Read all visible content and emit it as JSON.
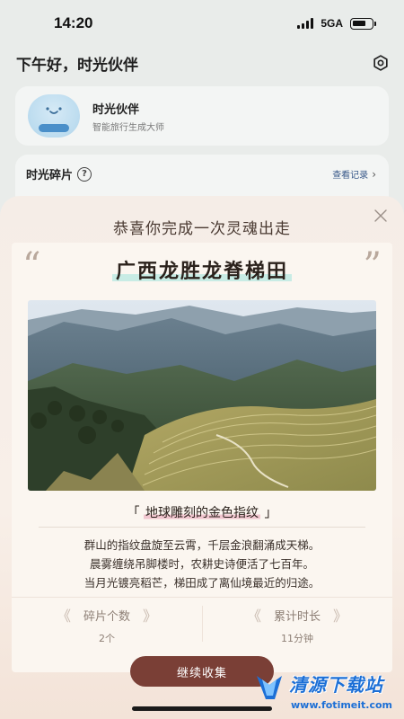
{
  "status_bar": {
    "time": "14:20",
    "network": "5GA"
  },
  "header": {
    "greeting": "下午好，时光伙伴"
  },
  "companion": {
    "name": "时光伙伴",
    "subtitle": "智能旅行生成大师"
  },
  "fragments": {
    "title": "时光碎片",
    "help": "?",
    "view_records": "查看记录"
  },
  "modal": {
    "title": "恭喜你完成一次灵魂出走",
    "place": "广西龙胜龙脊梯田",
    "tagline_open": "「",
    "tagline": "地球雕刻的金色指纹",
    "tagline_close": "」",
    "body": [
      "群山的指纹盘旋至云霄，千层金浪翻涌成天梯。",
      "晨雾缠绕吊脚楼时，农耕史诗便活了七百年。",
      "当月光镀亮稻芒，梯田成了离仙境最近的归途。"
    ],
    "stats": [
      {
        "label": "碎片个数",
        "value": "2个"
      },
      {
        "label": "累计时长",
        "value": "11分钟"
      }
    ],
    "continue_label": "继续收集"
  },
  "watermark": {
    "title": "清源下载站",
    "url": "www.fotimeit.com"
  },
  "colors": {
    "accent": "#7a3f36",
    "title_highlight": "#c8ece5",
    "tagline_highlight": "#f1c6cf"
  }
}
